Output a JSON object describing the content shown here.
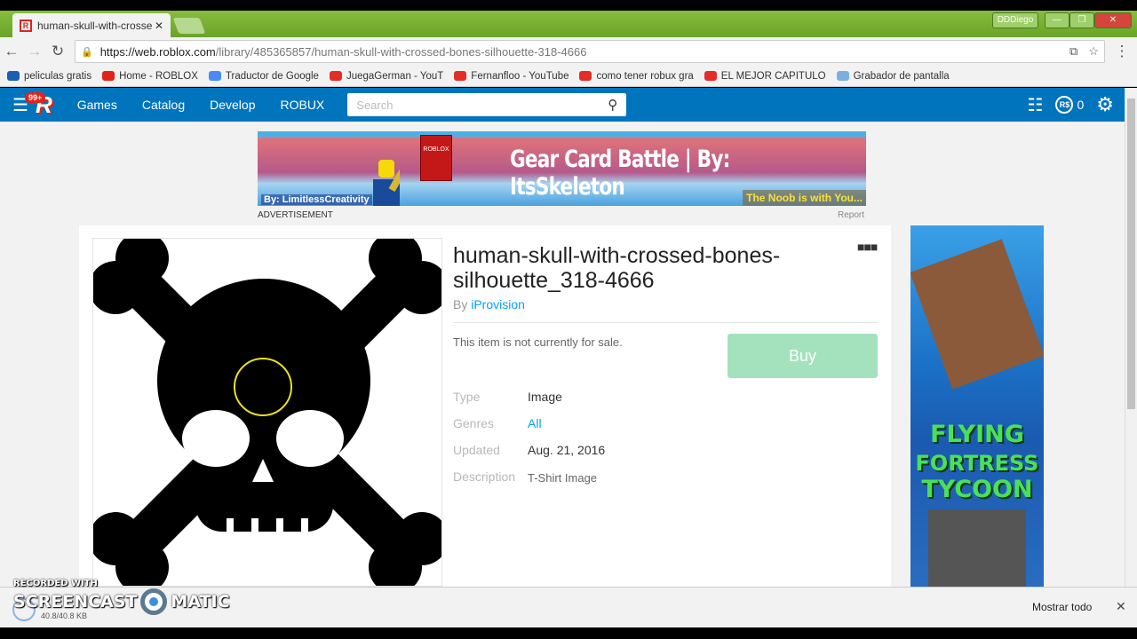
{
  "browser": {
    "tab_title": "human-skull-with-crosse",
    "url_host": "https://web.roblox.com",
    "url_path": "/library/485365857/human-skull-with-crossed-bones-silhouette-318-4666",
    "user_label": "DDDiego",
    "bookmarks": [
      {
        "label": "peliculas gratis",
        "icon": "globe-icon",
        "color": "#1a5fb4"
      },
      {
        "label": "Home - ROBLOX",
        "icon": "roblox-icon",
        "color": "#e2231a"
      },
      {
        "label": "Traductor de Google",
        "icon": "translate-icon",
        "color": "#4a8af4"
      },
      {
        "label": "JuegaGerman - YouT",
        "icon": "youtube-icon",
        "color": "#e52d27"
      },
      {
        "label": "Fernanfloo - YouTube",
        "icon": "youtube-icon",
        "color": "#e52d27"
      },
      {
        "label": "como tener robux gra",
        "icon": "youtube-icon",
        "color": "#e52d27"
      },
      {
        "label": "EL MEJOR CAPITULO",
        "icon": "youtube-icon",
        "color": "#e52d27"
      },
      {
        "label": "Grabador de pantalla",
        "icon": "record-icon",
        "color": "#7ab0e0"
      }
    ]
  },
  "roblox_nav": {
    "notification_count": "99+",
    "links": [
      "Games",
      "Catalog",
      "Develop",
      "ROBUX"
    ],
    "search_placeholder": "Search",
    "robux_balance": "0",
    "brand_color": "#0074bd"
  },
  "ad": {
    "title": "Gear Card Battle | By: ItsSkeleton",
    "by": "By: LimitlessCreativity",
    "tagline": "The Noob is with You...",
    "card_text": "ROBLOX",
    "label": "ADVERTISEMENT",
    "report": "Report"
  },
  "item": {
    "title": "human-skull-with-crossed-bones-silhouette_318-4666",
    "by_prefix": "By",
    "creator": "iProvision",
    "sale_status": "This item is not currently for sale.",
    "buy_label": "Buy",
    "details": [
      {
        "label": "Type",
        "value": "Image",
        "link": false
      },
      {
        "label": "Genres",
        "value": "All",
        "link": true
      },
      {
        "label": "Updated",
        "value": "Aug. 21, 2016",
        "link": false
      },
      {
        "label": "Description",
        "value": "T-Shirt Image",
        "link": false
      }
    ]
  },
  "side_ad": {
    "lines": [
      "FLYING",
      "FORTRESS",
      "TYCOON"
    ]
  },
  "download_bar": {
    "size": "40.8/40.8 KB",
    "show_all": "Mostrar todo"
  },
  "watermark": {
    "top": "RECORDED WITH",
    "left": "SCREENCAST",
    "right": "MATIC"
  }
}
